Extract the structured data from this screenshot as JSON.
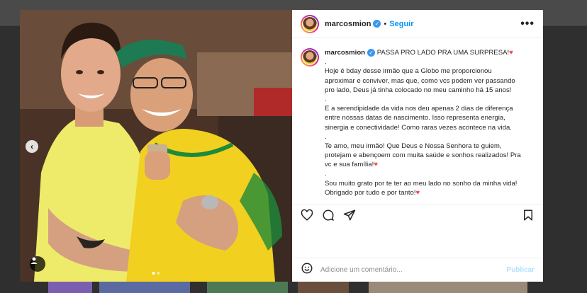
{
  "post": {
    "username": "marcosmion",
    "separator": "•",
    "follow_label": "Seguir",
    "more_label": "•••",
    "caption_lines": [
      {
        "text": "PASSA PRO LADO PRA UMA SURPRESA!",
        "heart": true,
        "bold_user": true
      },
      {
        "text": "."
      },
      {
        "text": "Hoje é bday desse irmão que a Globo me proporcionou"
      },
      {
        "text": "aproximar e conviver, mas que, como vcs podem ver passando"
      },
      {
        "text": "pro lado, Deus já tinha colocado no meu caminho há 15 anos!"
      },
      {
        "text": "."
      },
      {
        "text": "E a serendipidade da vida nos deu apenas 2 dias de diferença"
      },
      {
        "text": "entre nossas datas de nascimento. Isso representa energia,"
      },
      {
        "text": "sinergia e conectividade! Como raras vezes acontece na vida."
      },
      {
        "text": "."
      },
      {
        "text": "Te amo, meu irmão! Que Deus e Nossa Senhora te guiem,"
      },
      {
        "text": "protejam e abençoem com muita saúde e sonhos realizados! Pra"
      },
      {
        "text": "vc e sua família!",
        "heart": true
      },
      {
        "text": "."
      },
      {
        "text": "Sou muito grato por te ter ao meu lado no sonho da minha vida!"
      },
      {
        "text": "Obrigado por tudo e por tanto!",
        "heart": true
      }
    ],
    "heart_glyph": "♥",
    "comment_placeholder": "Adicione um comentário...",
    "publish_label": "Publicar",
    "carousel_total": 2,
    "carousel_active": 1
  },
  "icons": {
    "like": "heart-icon",
    "comment": "comment-icon",
    "share": "share-icon",
    "save": "bookmark-icon",
    "emoji": "emoji-icon",
    "prev": "chevron-left-icon",
    "tag": "user-tag-icon"
  },
  "colors": {
    "accent": "#0095f6",
    "heart": "#ed4956",
    "verified": "#3897f0",
    "publish_disabled": "#b2dffc"
  }
}
